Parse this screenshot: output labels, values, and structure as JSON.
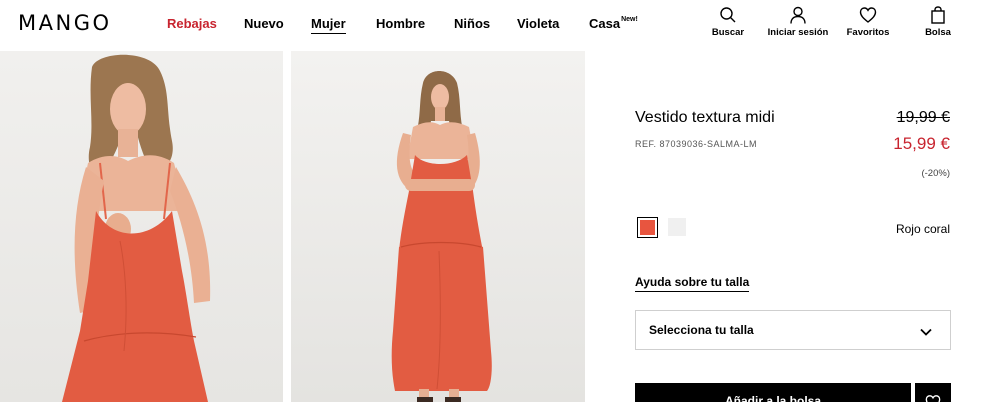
{
  "brand": {
    "logo": "MANGO"
  },
  "nav": [
    {
      "label": "Rebajas",
      "name": "nav-rebajas"
    },
    {
      "label": "Nuevo",
      "name": "nav-nuevo"
    },
    {
      "label": "Mujer",
      "name": "nav-mujer"
    },
    {
      "label": "Hombre",
      "name": "nav-hombre"
    },
    {
      "label": "Niños",
      "name": "nav-ninos"
    },
    {
      "label": "Violeta",
      "name": "nav-violeta"
    },
    {
      "label": "Casa",
      "badge": "New!",
      "name": "nav-casa"
    }
  ],
  "tools": {
    "search": "Buscar",
    "login": "Iniciar sesión",
    "favorites": "Favoritos",
    "bag": "Bolsa"
  },
  "product": {
    "title": "Vestido textura midi",
    "ref": "REF. 87039036-SALMA-LM",
    "old_price": "19,99 €",
    "new_price": "15,99 €",
    "discount": "(-20%)",
    "color_name": "Rojo coral",
    "help_link": "Ayuda sobre tu talla",
    "size_placeholder": "Selecciona tu talla",
    "add_button": "Añadir a la bolsa"
  },
  "colors": {
    "sale": "#c8242f",
    "swatch_selected": "#e8553f",
    "swatch_other": "#f0f0f0",
    "button": "#000000"
  },
  "icons": {
    "search": "search-icon",
    "user": "user-icon",
    "heart": "heart-icon",
    "bag": "bag-icon",
    "chevron": "chevron-down-icon"
  }
}
